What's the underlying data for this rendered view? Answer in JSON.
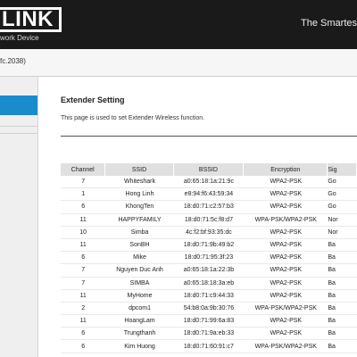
{
  "header": {
    "logo_text": "LINK",
    "logo_sub": "work Device",
    "tagline": "The Smartes",
    "version": "fc.2038)"
  },
  "page": {
    "title": "Extender Setting",
    "description": "This page is used to set Extender Wireless function."
  },
  "table": {
    "headers": [
      "Channel",
      "SSID",
      "BSSID",
      "Encryption",
      "Sig"
    ],
    "rows": [
      [
        "7",
        "Whiteshark",
        "a0:65:18:1a:21:9c",
        "WPA2-PSK",
        "Go"
      ],
      [
        "1",
        "Hong Linh",
        "e8:94:f6:43:59:34",
        "WPA2-PSK",
        "Go"
      ],
      [
        "6",
        "KhongTen",
        "18:d0:71:c2:57:b3",
        "WPA2-PSK",
        "Go"
      ],
      [
        "11",
        "HAPPYFAMILY",
        "18:d0:71:5c:f8:d7",
        "WPA-PSK/WPA2-PSK",
        "Nor"
      ],
      [
        "10",
        "Simba",
        "4c:f2:bf:93:35:dc",
        "WPA2-PSK",
        "Nor"
      ],
      [
        "11",
        "SonBH",
        "18:d0:71:9b:49:b2",
        "WPA2-PSK",
        "Ba"
      ],
      [
        "6",
        "Mike",
        "18:d0:71:95:3f:23",
        "WPA2-PSK",
        "Ba"
      ],
      [
        "7",
        "Nguyen Duc Anh",
        "a0:65:18:1a:22:3b",
        "WPA2-PSK",
        "Ba"
      ],
      [
        "7",
        "SIMBA",
        "a0:65:18:18:3a:eb",
        "WPA2-PSK",
        "Ba"
      ],
      [
        "11",
        "MyHome",
        "18:d0:71:c9:44:33",
        "WPA2-PSK",
        "Ba"
      ],
      [
        "2",
        "dpcom1",
        "54:b8:0a:9b:30:76",
        "WPA-PSK/WPA2-PSK",
        "Ba"
      ],
      [
        "11",
        "HoangLam",
        "18:d0:71:99:6a:83",
        "WPA2-PSK",
        "Ba"
      ],
      [
        "6",
        "Trungthanh",
        "18:d0:71:9a:eb:33",
        "WPA2-PSK",
        "Ba"
      ],
      [
        "6",
        "Kim Huong",
        "18:d0:71:60:91:c7",
        "WPA-PSK/WPA2-PSK",
        "Ba"
      ]
    ]
  }
}
